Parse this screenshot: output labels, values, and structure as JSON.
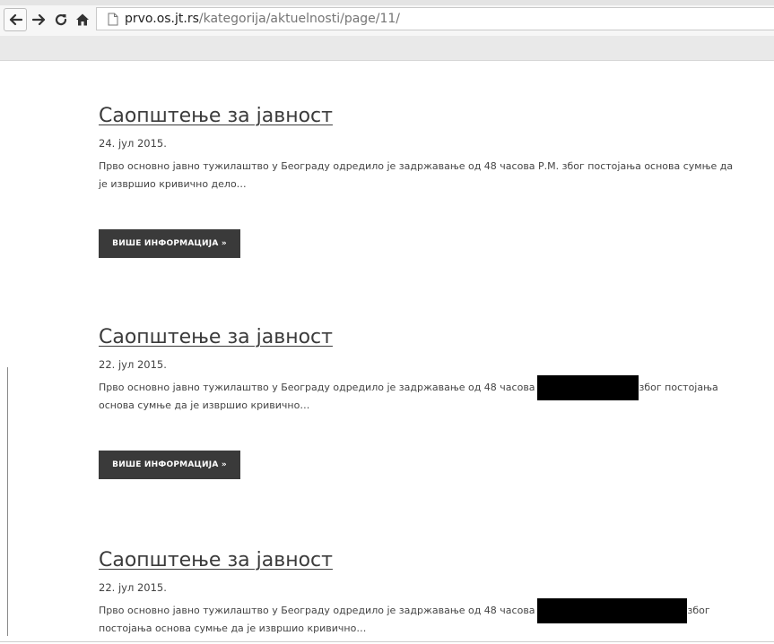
{
  "browser": {
    "url_host": "prvo.os.jt.rs",
    "url_path": "/kategorija/aktuelnosti/page/11/"
  },
  "posts": [
    {
      "title": "Саопштење за јавност",
      "date": "24. јул 2015.",
      "excerpt_line1": "Прво основно јавно тужилаштво у Београду одредило је задржавање од 48 часова Р.М. због постојања основа сумње да",
      "excerpt_line2": "је извршио кривично дело…",
      "button_label": "ВИШЕ ИНФОРМАЦИЈА »"
    },
    {
      "title": "Саопштење за јавност",
      "date": "22. јул 2015.",
      "excerpt_line1_before": "Прво основно јавно тужилаштво у Београду одредило је задржавање од 48 часова",
      "excerpt_line1_after": "због постојања",
      "excerpt_line2": "основа сумње да је извршио кривично…",
      "button_label": "ВИШЕ ИНФОРМАЦИЈА »"
    },
    {
      "title": "Саопштење за јавност",
      "date": "22. јул 2015.",
      "excerpt_line1_before": "Прво основно јавно тужилаштво у Београду одредило је задржавање од 48 часова",
      "excerpt_line1_after": "због",
      "excerpt_line2": "постојања основа сумње да је извршио кривично…"
    }
  ],
  "icons": {
    "back": "back-arrow-icon",
    "forward": "forward-arrow-icon",
    "reload": "reload-icon",
    "home": "home-icon",
    "page": "page-icon"
  },
  "colors": {
    "button_bg": "#3a3a3a",
    "text": "#444444",
    "redaction": "#000000"
  }
}
